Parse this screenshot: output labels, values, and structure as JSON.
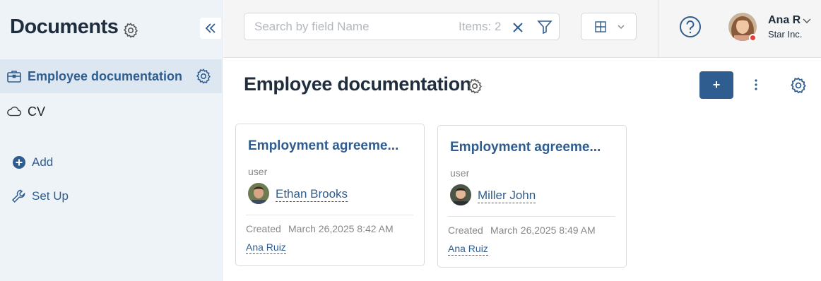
{
  "sidebar": {
    "title": "Documents",
    "items": [
      {
        "label": "Employee documentation",
        "icon": "briefcase-icon",
        "active": true
      },
      {
        "label": "CV",
        "icon": "cloud-icon",
        "active": false
      }
    ],
    "actions": [
      {
        "label": "Add",
        "icon": "plus-circle-icon"
      },
      {
        "label": "Set Up",
        "icon": "wrench-icon"
      }
    ]
  },
  "topbar": {
    "search": {
      "placeholder": "Search by field Name",
      "value": "",
      "items_count": "Items: 2"
    },
    "user": {
      "name": "Ana R",
      "company": "Star Inc.",
      "status_color": "#e5403a"
    }
  },
  "main": {
    "title": "Employee documentation",
    "add_label": "+",
    "cards": [
      {
        "title": "Employment agreeme...",
        "field_label": "user",
        "user": "Ethan Brooks",
        "created_label": "Created",
        "created_date": "March 26,2025 8:42 AM",
        "author": "Ana Ruiz"
      },
      {
        "title": "Employment agreeme...",
        "field_label": "user",
        "user": "Miller John",
        "created_label": "Created",
        "created_date": "March 26,2025 8:49 AM",
        "author": "Ana Ruiz"
      }
    ]
  },
  "colors": {
    "accent": "#2f5d8f",
    "sidebar_bg": "#eef3f8",
    "sidebar_active_bg": "#dde7f1"
  }
}
